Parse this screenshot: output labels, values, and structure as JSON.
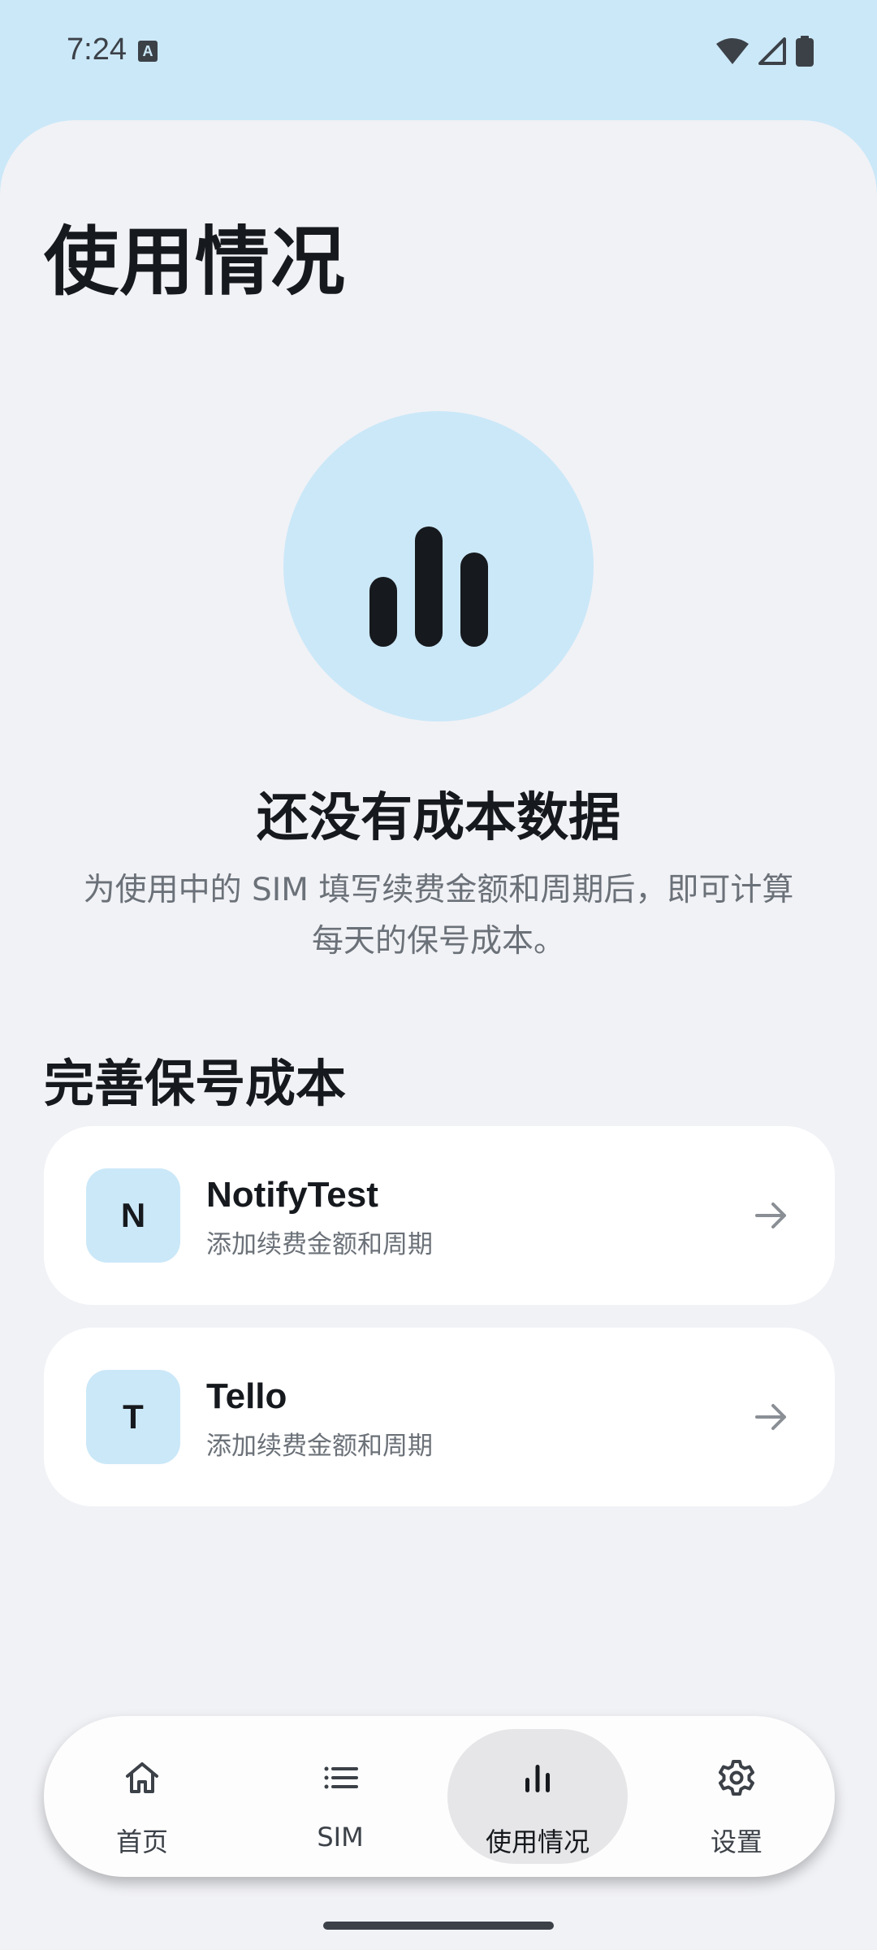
{
  "status_bar": {
    "time": "7:24",
    "indicator_letter": "A"
  },
  "page": {
    "title": "使用情况"
  },
  "empty_state": {
    "icon": "bar-chart-icon",
    "title": "还没有成本数据",
    "description": "为使用中的 SIM 填写续费金额和周期后，即可计算每天的保号成本。"
  },
  "section": {
    "title": "完善保号成本"
  },
  "sims": [
    {
      "initial": "N",
      "name": "NotifyTest",
      "subtitle": "添加续费金额和周期"
    },
    {
      "initial": "T",
      "name": "Tello",
      "subtitle": "添加续费金额和周期"
    }
  ],
  "nav": {
    "items": [
      {
        "label": "首页",
        "icon": "home-icon"
      },
      {
        "label": "SIM",
        "icon": "list-icon"
      },
      {
        "label": "使用情况",
        "icon": "bar-chart-icon",
        "active": true
      },
      {
        "label": "设置",
        "icon": "gear-icon"
      }
    ]
  },
  "colors": {
    "accent_surface": "#cbe8f8",
    "background": "#f1f2f6",
    "card": "#ffffff",
    "text_primary": "#16191d",
    "text_secondary": "#6b7178"
  }
}
